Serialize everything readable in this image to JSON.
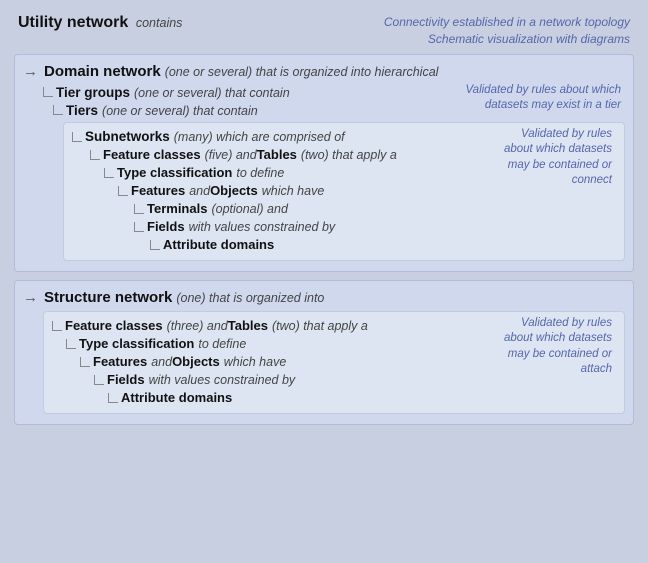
{
  "header": {
    "title": "Utility network",
    "title_desc": " contains",
    "top_note_line1": "Connectivity established in a network topology",
    "top_note_line2": "Schematic visualization with diagrams"
  },
  "domain_block": {
    "label": "Domain network",
    "desc": " (one or several) that is organized into hierarchical",
    "side_note_tiers": "Validated by rules about which datasets may exist in a tier",
    "tier_groups": {
      "label": "Tier groups",
      "desc": " (one or several) that contain"
    },
    "tiers": {
      "label": "Tiers",
      "desc": " (one or several) that contain"
    },
    "inner": {
      "subnetworks": {
        "label": "Subnetworks",
        "desc": " (many) which are comprised of"
      },
      "side_note_subnetworks": "Validated by rules about which datasets may be contained or connect",
      "feature_classes": {
        "label": "Feature classes",
        "desc_mid": " (five) and ",
        "tables_label": "Tables",
        "desc_end": " (two) that apply a"
      },
      "type_classification": {
        "label": "Type classification",
        "desc": " to define"
      },
      "features": {
        "label": "Features",
        "desc_mid": " and ",
        "objects_label": "Objects",
        "desc_end": " which have"
      },
      "terminals": {
        "label": "Terminals",
        "desc": " (optional) and"
      },
      "fields": {
        "label": "Fields",
        "desc": " with values constrained by"
      },
      "attribute_domains": {
        "label": "Attribute domains"
      }
    }
  },
  "structure_block": {
    "label": "Structure network",
    "desc": " (one) that is organized into",
    "inner": {
      "feature_classes": {
        "label": "Feature classes",
        "desc_mid": " (three) and ",
        "tables_label": "Tables",
        "desc_end": " (two) that apply a"
      },
      "side_note": "Validated by rules about which datasets may be contained or attach",
      "type_classification": {
        "label": "Type classification",
        "desc": " to define"
      },
      "features": {
        "label": "Features",
        "desc_mid": " and ",
        "objects_label": "Objects",
        "desc_end": " which have"
      },
      "fields": {
        "label": "Fields",
        "desc": " with values constrained by"
      },
      "attribute_domains": {
        "label": "Attribute domains"
      }
    }
  }
}
